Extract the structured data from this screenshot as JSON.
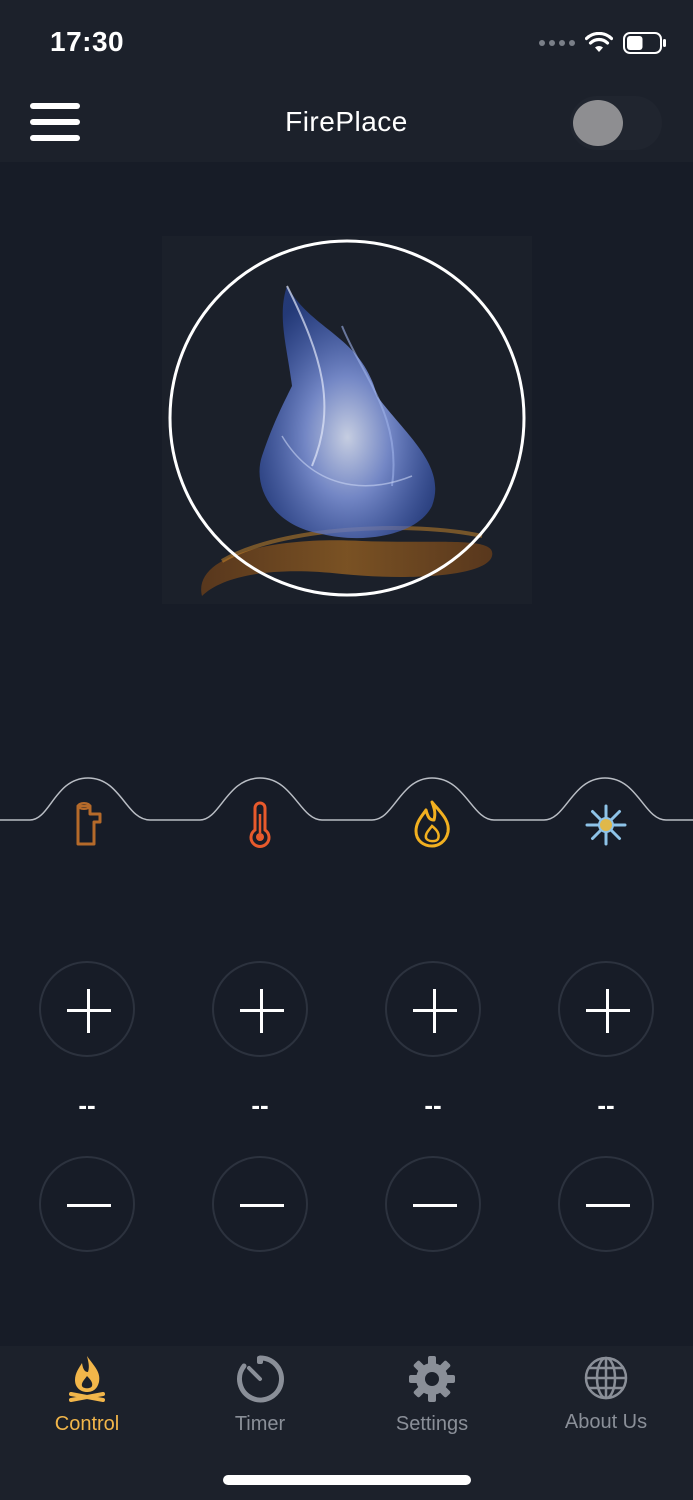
{
  "status_bar": {
    "time": "17:30",
    "battery_level": 0.5
  },
  "header": {
    "title": "FirePlace",
    "power_on": false
  },
  "colors": {
    "active": "#f2b64a",
    "inactive": "#8a8f98",
    "log": "#b56a2a",
    "temperature": "#e85a2c",
    "flame": "#f2b020",
    "fan": "#8ec3e8"
  },
  "modes": [
    {
      "name": "log",
      "icon": "log-icon",
      "value": "--"
    },
    {
      "name": "temperature",
      "icon": "thermometer-icon",
      "value": "--"
    },
    {
      "name": "flame",
      "icon": "flame-icon",
      "value": "--"
    },
    {
      "name": "fan",
      "icon": "snowflake-icon",
      "value": "--"
    }
  ],
  "tabbar": {
    "items": [
      {
        "label": "Control",
        "icon": "campfire-icon",
        "active": true
      },
      {
        "label": "Timer",
        "icon": "timer-icon",
        "active": false
      },
      {
        "label": "Settings",
        "icon": "gear-icon",
        "active": false
      },
      {
        "label": "About Us",
        "icon": "globe-icon",
        "active": false
      }
    ]
  }
}
